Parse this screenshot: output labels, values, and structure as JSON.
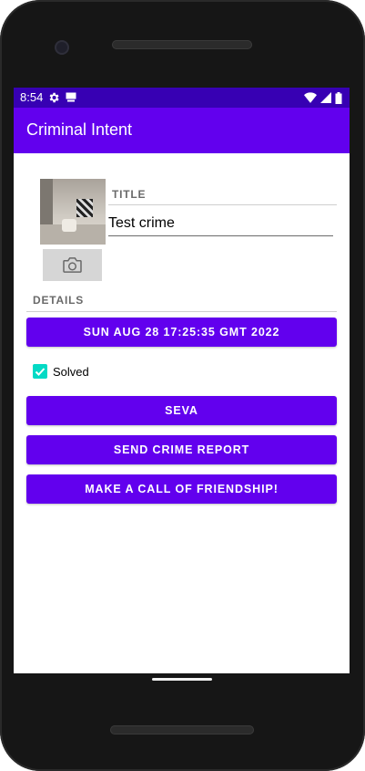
{
  "status_bar": {
    "time": "8:54"
  },
  "app_bar": {
    "title": "Criminal Intent"
  },
  "crime": {
    "title_label": "TITLE",
    "title_value": "Test crime",
    "details_label": "DETAILS",
    "date_button": "SUN AUG 28 17:25:35 GMT 2022",
    "solved_label": "Solved",
    "solved_checked": true
  },
  "buttons": {
    "seva": "SEVA",
    "send_report": "SEND CRIME REPORT",
    "call_friendship": "MAKE A CALL OF FRIENDSHIP!"
  },
  "colors": {
    "status_bar": "#3700B3",
    "app_bar": "#6200EE",
    "button": "#6200EE",
    "checkbox": "#03DAC5"
  },
  "icons": {
    "settings": "gear-icon",
    "sim": "sim-card-icon",
    "wifi": "wifi-icon",
    "signal": "signal-icon",
    "battery": "battery-icon",
    "camera": "camera-icon"
  }
}
